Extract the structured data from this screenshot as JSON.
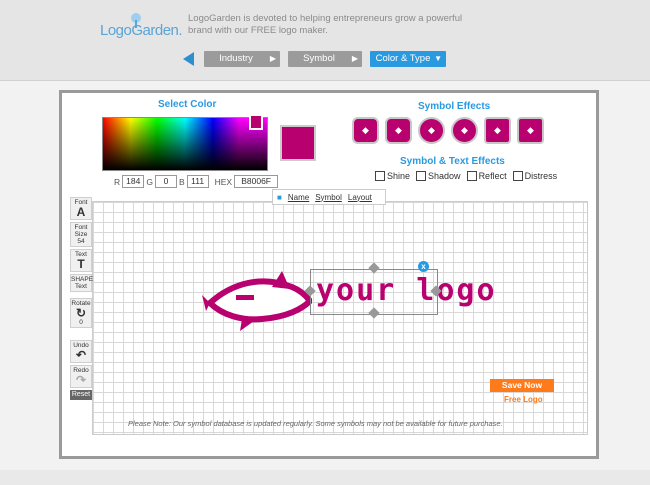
{
  "header": {
    "logo": "LogoGarden.",
    "tagline": "LogoGarden is devoted to helping entrepreneurs grow a powerful brand with our FREE logo maker."
  },
  "nav": {
    "steps": [
      {
        "label": "Industry",
        "arrow": "▶"
      },
      {
        "label": "Symbol",
        "arrow": "▶"
      },
      {
        "label": "Color & Type",
        "arrow": "▼"
      }
    ]
  },
  "color": {
    "title": "Select Color",
    "r_label": "R",
    "r": "184",
    "g_label": "G",
    "g": "0",
    "b_label": "B",
    "b": "111",
    "hex_label": "HEX",
    "hex": "B8006F",
    "swatch": "#b8006f"
  },
  "symbol_effects": {
    "title": "Symbol Effects",
    "count": 6
  },
  "text_effects": {
    "title": "Symbol & Text Effects",
    "options": [
      "Shine",
      "Shadow",
      "Reflect",
      "Distress"
    ]
  },
  "tabs": [
    "Name",
    "Symbol",
    "Layout"
  ],
  "tools": {
    "font": "Font",
    "font_size": "Font Size",
    "font_size_value": "54",
    "text": "Text",
    "shape": "SHAPE Text",
    "rotate": "Rotate",
    "rotate_value": "0",
    "undo": "Undo",
    "redo": "Redo",
    "reset": "Reset"
  },
  "canvas": {
    "logo_text": "your logo",
    "close": "x",
    "note": "Please Note: Our symbol database is updated regularly. Some symbols may not be available for future purchase."
  },
  "cta": {
    "save": "Save Now",
    "free": "Free Logo"
  },
  "colors": {
    "accent": "#2a9ae0",
    "brand": "#b8006f",
    "cta": "#ff7a1a"
  }
}
